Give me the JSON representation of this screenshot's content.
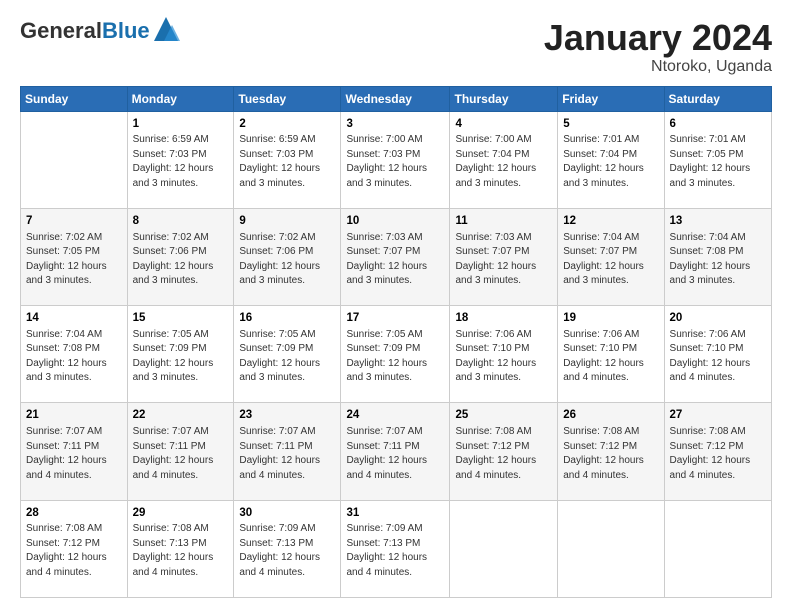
{
  "logo": {
    "general": "General",
    "blue": "Blue"
  },
  "header": {
    "title": "January 2024",
    "subtitle": "Ntoroko, Uganda"
  },
  "weekdays": [
    "Sunday",
    "Monday",
    "Tuesday",
    "Wednesday",
    "Thursday",
    "Friday",
    "Saturday"
  ],
  "weeks": [
    [
      {
        "day": "",
        "info": ""
      },
      {
        "day": "1",
        "info": "Sunrise: 6:59 AM\nSunset: 7:03 PM\nDaylight: 12 hours\nand 3 minutes."
      },
      {
        "day": "2",
        "info": "Sunrise: 6:59 AM\nSunset: 7:03 PM\nDaylight: 12 hours\nand 3 minutes."
      },
      {
        "day": "3",
        "info": "Sunrise: 7:00 AM\nSunset: 7:03 PM\nDaylight: 12 hours\nand 3 minutes."
      },
      {
        "day": "4",
        "info": "Sunrise: 7:00 AM\nSunset: 7:04 PM\nDaylight: 12 hours\nand 3 minutes."
      },
      {
        "day": "5",
        "info": "Sunrise: 7:01 AM\nSunset: 7:04 PM\nDaylight: 12 hours\nand 3 minutes."
      },
      {
        "day": "6",
        "info": "Sunrise: 7:01 AM\nSunset: 7:05 PM\nDaylight: 12 hours\nand 3 minutes."
      }
    ],
    [
      {
        "day": "7",
        "info": "Sunrise: 7:02 AM\nSunset: 7:05 PM\nDaylight: 12 hours\nand 3 minutes."
      },
      {
        "day": "8",
        "info": "Sunrise: 7:02 AM\nSunset: 7:06 PM\nDaylight: 12 hours\nand 3 minutes."
      },
      {
        "day": "9",
        "info": "Sunrise: 7:02 AM\nSunset: 7:06 PM\nDaylight: 12 hours\nand 3 minutes."
      },
      {
        "day": "10",
        "info": "Sunrise: 7:03 AM\nSunset: 7:07 PM\nDaylight: 12 hours\nand 3 minutes."
      },
      {
        "day": "11",
        "info": "Sunrise: 7:03 AM\nSunset: 7:07 PM\nDaylight: 12 hours\nand 3 minutes."
      },
      {
        "day": "12",
        "info": "Sunrise: 7:04 AM\nSunset: 7:07 PM\nDaylight: 12 hours\nand 3 minutes."
      },
      {
        "day": "13",
        "info": "Sunrise: 7:04 AM\nSunset: 7:08 PM\nDaylight: 12 hours\nand 3 minutes."
      }
    ],
    [
      {
        "day": "14",
        "info": "Sunrise: 7:04 AM\nSunset: 7:08 PM\nDaylight: 12 hours\nand 3 minutes."
      },
      {
        "day": "15",
        "info": "Sunrise: 7:05 AM\nSunset: 7:09 PM\nDaylight: 12 hours\nand 3 minutes."
      },
      {
        "day": "16",
        "info": "Sunrise: 7:05 AM\nSunset: 7:09 PM\nDaylight: 12 hours\nand 3 minutes."
      },
      {
        "day": "17",
        "info": "Sunrise: 7:05 AM\nSunset: 7:09 PM\nDaylight: 12 hours\nand 3 minutes."
      },
      {
        "day": "18",
        "info": "Sunrise: 7:06 AM\nSunset: 7:10 PM\nDaylight: 12 hours\nand 3 minutes."
      },
      {
        "day": "19",
        "info": "Sunrise: 7:06 AM\nSunset: 7:10 PM\nDaylight: 12 hours\nand 4 minutes."
      },
      {
        "day": "20",
        "info": "Sunrise: 7:06 AM\nSunset: 7:10 PM\nDaylight: 12 hours\nand 4 minutes."
      }
    ],
    [
      {
        "day": "21",
        "info": "Sunrise: 7:07 AM\nSunset: 7:11 PM\nDaylight: 12 hours\nand 4 minutes."
      },
      {
        "day": "22",
        "info": "Sunrise: 7:07 AM\nSunset: 7:11 PM\nDaylight: 12 hours\nand 4 minutes."
      },
      {
        "day": "23",
        "info": "Sunrise: 7:07 AM\nSunset: 7:11 PM\nDaylight: 12 hours\nand 4 minutes."
      },
      {
        "day": "24",
        "info": "Sunrise: 7:07 AM\nSunset: 7:11 PM\nDaylight: 12 hours\nand 4 minutes."
      },
      {
        "day": "25",
        "info": "Sunrise: 7:08 AM\nSunset: 7:12 PM\nDaylight: 12 hours\nand 4 minutes."
      },
      {
        "day": "26",
        "info": "Sunrise: 7:08 AM\nSunset: 7:12 PM\nDaylight: 12 hours\nand 4 minutes."
      },
      {
        "day": "27",
        "info": "Sunrise: 7:08 AM\nSunset: 7:12 PM\nDaylight: 12 hours\nand 4 minutes."
      }
    ],
    [
      {
        "day": "28",
        "info": "Sunrise: 7:08 AM\nSunset: 7:12 PM\nDaylight: 12 hours\nand 4 minutes."
      },
      {
        "day": "29",
        "info": "Sunrise: 7:08 AM\nSunset: 7:13 PM\nDaylight: 12 hours\nand 4 minutes."
      },
      {
        "day": "30",
        "info": "Sunrise: 7:09 AM\nSunset: 7:13 PM\nDaylight: 12 hours\nand 4 minutes."
      },
      {
        "day": "31",
        "info": "Sunrise: 7:09 AM\nSunset: 7:13 PM\nDaylight: 12 hours\nand 4 minutes."
      },
      {
        "day": "",
        "info": ""
      },
      {
        "day": "",
        "info": ""
      },
      {
        "day": "",
        "info": ""
      }
    ]
  ]
}
